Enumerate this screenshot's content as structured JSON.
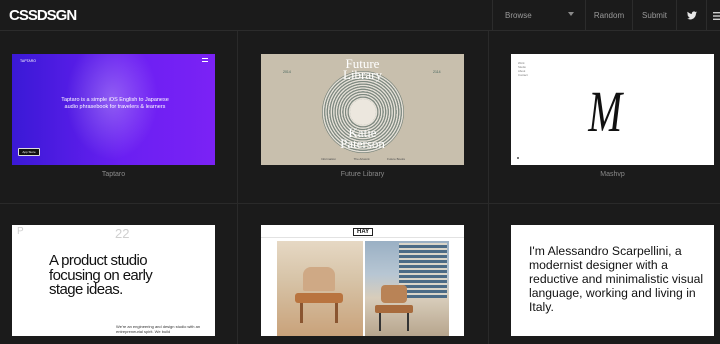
{
  "header": {
    "logo": "CSSDSGN",
    "browse_label": "Browse",
    "random_label": "Random",
    "submit_label": "Submit",
    "twitter_icon": "twitter-icon",
    "menu_icon": "hamburger-menu-icon"
  },
  "sites": [
    {
      "caption": "Taptaro",
      "brand": "TAPTARO",
      "pitch": "Taptaro is a simple iOS English to Japanese audio phrasebook for travelers & learners",
      "store": "App Store"
    },
    {
      "caption": "Future Library",
      "title_line1": "Future",
      "title_line2": "Library",
      "name_line1": "Katie",
      "name_line2": "Paterson",
      "date_left": "2014",
      "date_right": "2114",
      "foot": [
        "Information",
        "The Artwork",
        "Future Books"
      ]
    },
    {
      "caption": "Mashvp",
      "nav": [
        "Work",
        "Studio",
        "About",
        "Contact"
      ],
      "mark": "M"
    },
    {
      "letter": "P",
      "number": "22",
      "pitch": "A product studio focusing on early stage ideas.",
      "sub": "We're an engineering and design studio with an entrepreneurial spirit. We build"
    },
    {
      "logo": "HAY"
    },
    {
      "text": "I'm Alessandro Scarpellini, a modernist designer with a reductive and minimalistic visual language, working and living in Italy."
    }
  ]
}
